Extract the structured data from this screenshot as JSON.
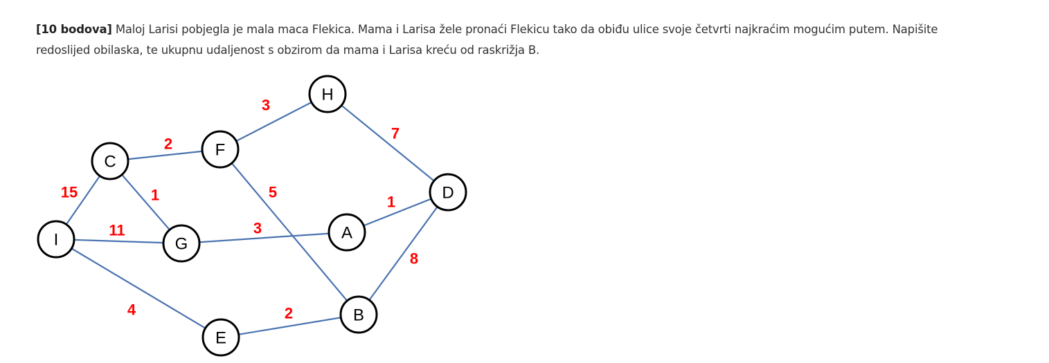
{
  "task": {
    "points": "[10 bodova]",
    "line1": "Maloj Larisi pobjegla je mala maca Flekica. Mama i Larisa žele pronaći Flekicu tako da obiđu ulice svoje četvrti najkraćim mogućim putem. Napišite",
    "line2": "redoslijed obilaska, te ukupnu udaljenost s obzirom da mama i Larisa kreću od raskrižja B."
  },
  "graph": {
    "nodes": [
      "H",
      "C",
      "F",
      "D",
      "I",
      "G",
      "A",
      "B",
      "E"
    ],
    "edges": [
      {
        "from": "F",
        "to": "H",
        "weight": "3"
      },
      {
        "from": "H",
        "to": "D",
        "weight": "7"
      },
      {
        "from": "C",
        "to": "F",
        "weight": "2"
      },
      {
        "from": "C",
        "to": "I",
        "weight": "15"
      },
      {
        "from": "C",
        "to": "G",
        "weight": "1"
      },
      {
        "from": "F",
        "to": "B",
        "weight": "5"
      },
      {
        "from": "A",
        "to": "D",
        "weight": "1"
      },
      {
        "from": "I",
        "to": "G",
        "weight": "11"
      },
      {
        "from": "G",
        "to": "A",
        "weight": "3"
      },
      {
        "from": "D",
        "to": "B",
        "weight": "8"
      },
      {
        "from": "I",
        "to": "E",
        "weight": "4"
      },
      {
        "from": "E",
        "to": "B",
        "weight": "2"
      }
    ]
  },
  "colors": {
    "edge": "#4a72b0",
    "weight": "#ff0000",
    "node_border": "#000000"
  }
}
